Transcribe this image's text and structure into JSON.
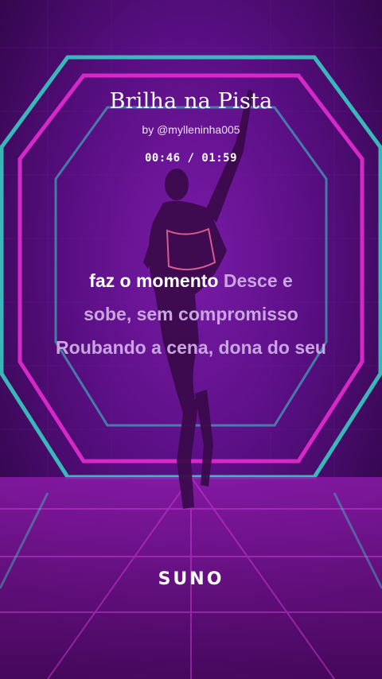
{
  "song": {
    "title": "Brilha na Pista",
    "artist": "by @mylleninha005"
  },
  "player": {
    "elapsed": "00:46",
    "separator": " / ",
    "duration": "01:59"
  },
  "lyrics": [
    {
      "sung": "faz o momento ",
      "unsung": "Desce e"
    },
    {
      "sung": "",
      "unsung": "sobe, sem compromisso"
    },
    {
      "sung": "",
      "unsung": "Roubando a cena, dona do seu"
    }
  ],
  "brand": {
    "logo_text": "SUNO"
  },
  "colors": {
    "accent_magenta": "#e62bd0",
    "accent_cyan": "#38d6c8",
    "background": "#4a0a6a"
  }
}
